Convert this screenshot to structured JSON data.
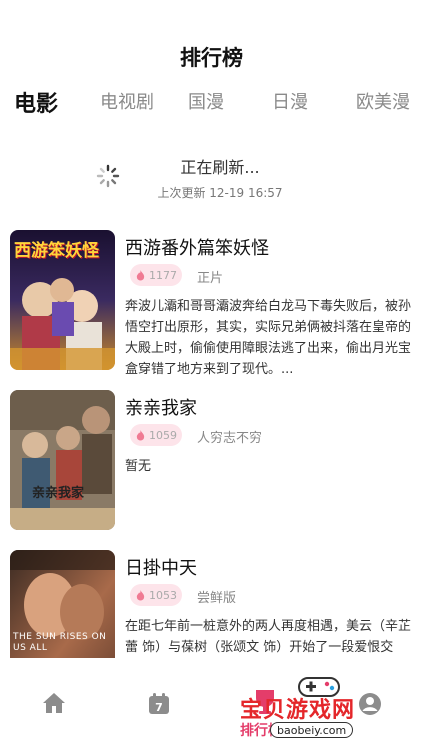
{
  "header": {
    "title": "排行榜"
  },
  "tabs": [
    {
      "label": "电影",
      "active": true
    },
    {
      "label": "电视剧"
    },
    {
      "label": "国漫"
    },
    {
      "label": "日漫"
    },
    {
      "label": "欧美漫"
    }
  ],
  "refresh": {
    "status": "正在刷新...",
    "last_update": "上次更新 12-19 16:57"
  },
  "items": [
    {
      "title": "西游番外篇笨妖怪",
      "heat": "1177",
      "tag": "正片",
      "poster_text": "西游笨妖怪",
      "description": "奔波儿灞和哥哥灞波奔给白龙马下毒失败后，被孙悟空打出原形，其实，实际兄弟俩被抖落在皇帝的大殿上时，偷偷使用障眼法逃了出来，偷出月光宝盒穿错了地方来到了现代。..."
    },
    {
      "title": "亲亲我家",
      "heat": "1059",
      "tag": "人穷志不穷",
      "poster_text": "亲亲我家",
      "description": "暂无"
    },
    {
      "title": "日掛中天",
      "heat": "1053",
      "tag": "尝鲜版",
      "poster_text": "THE SUN RISES ON US ALL",
      "description": "在距七年前一桩意外的两人再度相遇，美云（辛芷蕾 饰）与葆树（张颂文 饰）开始了一段爱恨交织、纠缠不清的情感关系。"
    }
  ],
  "bottom_nav": {
    "active_label": "排行榜",
    "calendar_day": "7"
  },
  "watermark": {
    "text": "宝贝游戏网",
    "url": "baobeiy.com"
  },
  "colors": {
    "accent": "#e43d6a",
    "heat_bg": "#fde4ea"
  }
}
